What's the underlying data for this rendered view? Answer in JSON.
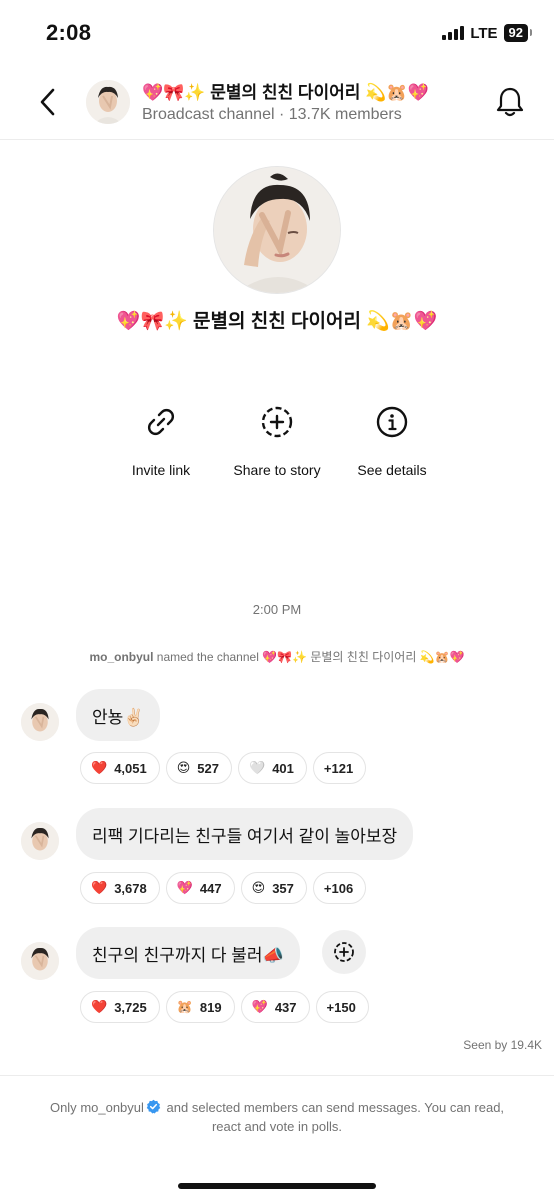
{
  "status_bar": {
    "time": "2:08",
    "network": "LTE",
    "battery": "92"
  },
  "header": {
    "title": "💖🎀✨ 문별의 친친 다이어리 💫🐹💖",
    "subtitle": "Broadcast channel · 13.7K members"
  },
  "profile": {
    "name": "💖🎀✨ 문별의 친친 다이어리 💫🐹💖"
  },
  "actions": [
    {
      "label": "Invite link",
      "icon": "link-icon"
    },
    {
      "label": "Share to story",
      "icon": "add-story-icon"
    },
    {
      "label": "See details",
      "icon": "info-icon"
    }
  ],
  "timeline": {
    "time": "2:00 PM",
    "system_user": "mo_onbyul",
    "system_text": " named the channel 💖🎀✨ 문별의 친친 다이어리 💫🐹💖"
  },
  "messages": [
    {
      "text": "안뇽✌🏻",
      "reactions": [
        {
          "emoji": "❤️",
          "count": "4,051"
        },
        {
          "emoji": "😍",
          "count": "527"
        },
        {
          "emoji": "🤍",
          "count": "401"
        },
        {
          "emoji": "",
          "count": "+121"
        }
      ]
    },
    {
      "text": "리팩 기다리는 친구들 여기서 같이 놀아보장",
      "reactions": [
        {
          "emoji": "❤️",
          "count": "3,678"
        },
        {
          "emoji": "💖",
          "count": "447"
        },
        {
          "emoji": "😍",
          "count": "357"
        },
        {
          "emoji": "",
          "count": "+106"
        }
      ]
    },
    {
      "text": "친구의 친구까지 다 불러📣",
      "reactions": [
        {
          "emoji": "❤️",
          "count": "3,725"
        },
        {
          "emoji": "🐹",
          "count": "819"
        },
        {
          "emoji": "💖",
          "count": "437"
        },
        {
          "emoji": "",
          "count": "+150"
        }
      ]
    }
  ],
  "seen": "Seen by 19.4K",
  "footer": {
    "user": "mo_onbyul",
    "text_before": "Only",
    "text_after": "and selected members can send messages. You can read, react and vote in polls."
  },
  "colors": {
    "accent": "#3897f0",
    "secondary_text": "#737373",
    "bubble": "#efefef"
  }
}
